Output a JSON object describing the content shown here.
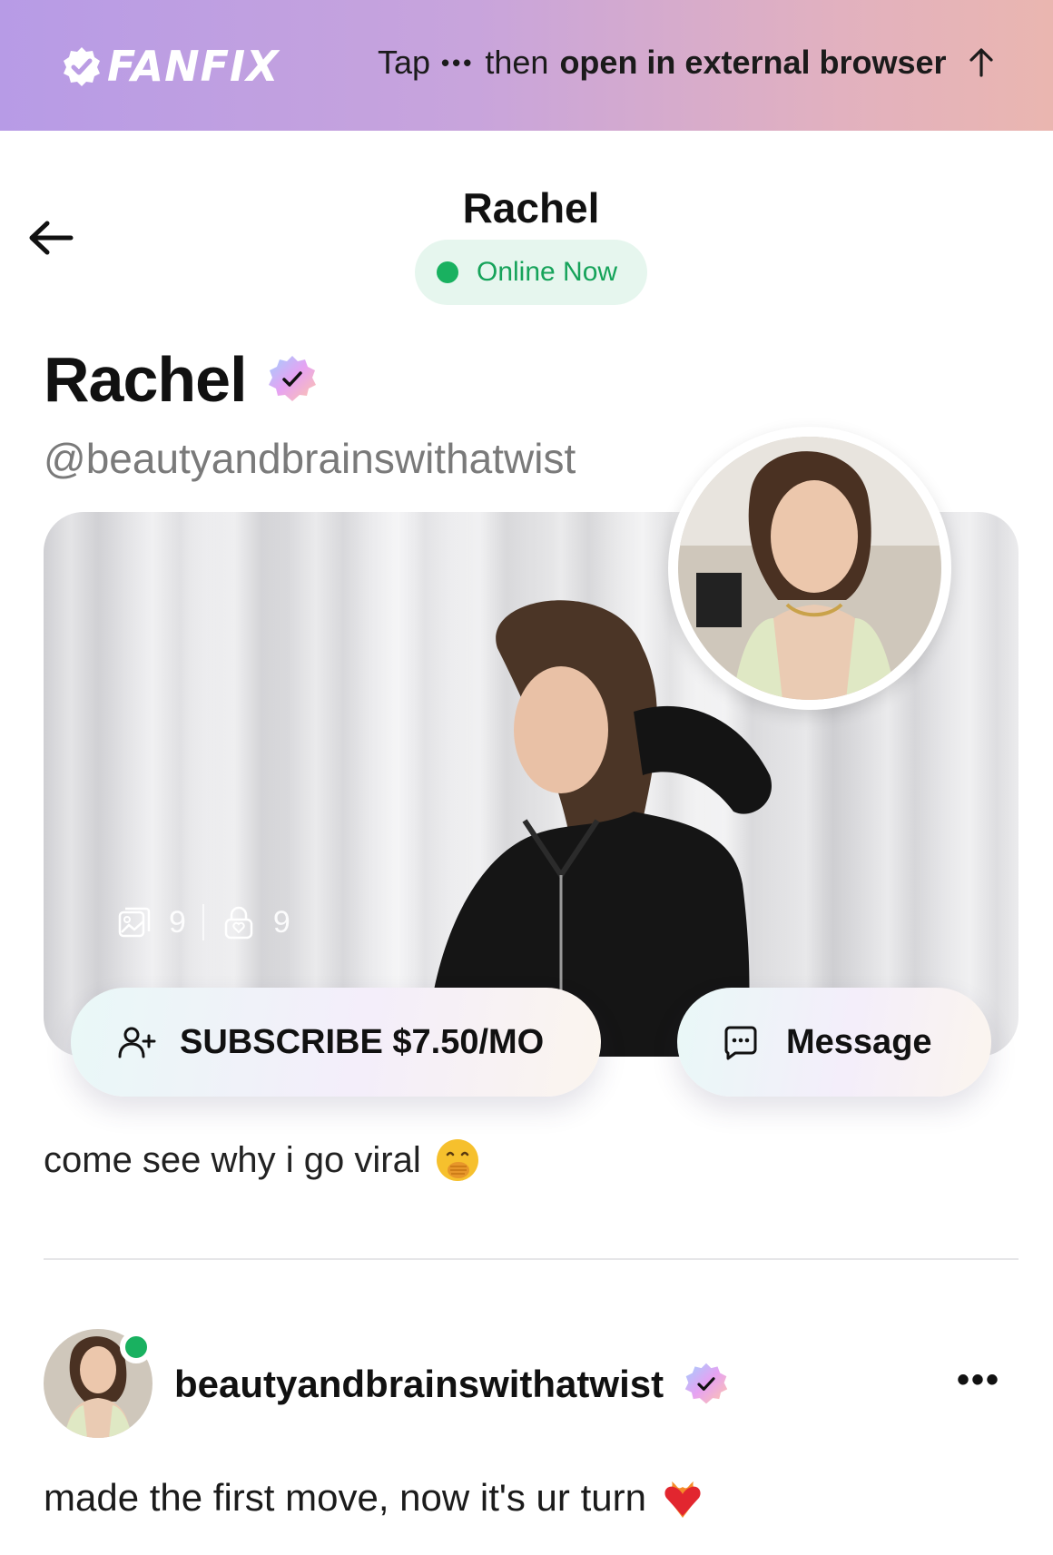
{
  "banner": {
    "logo_text": "FANFIX",
    "tap": "Tap",
    "dots": "•••",
    "then": "then",
    "instruction": "open in external browser"
  },
  "header": {
    "title": "Rachel",
    "status": "Online Now"
  },
  "profile": {
    "name": "Rachel",
    "handle": "@beautyandbrainswithatwist",
    "media_count": "9",
    "locked_count": "9",
    "bio": "come see why i go viral"
  },
  "actions": {
    "subscribe_label": "SUBSCRIBE $7.50/MO",
    "message_label": "Message"
  },
  "post": {
    "username": "beautyandbrainswithatwist",
    "more": "•••",
    "text": "made the first move, now it's ur turn"
  },
  "icons": {
    "back": "arrow-left-icon",
    "up": "arrow-up-icon",
    "verified": "verified-badge-icon",
    "gallery": "gallery-icon",
    "lock": "lock-icon",
    "add_user": "add-user-icon",
    "chat": "chat-bubble-icon",
    "emoji_bio": "hand-over-mouth-emoji",
    "emoji_post": "heart-on-fire-emoji"
  },
  "colors": {
    "online_green": "#19b160",
    "online_bg": "#e6f6ee",
    "banner_start": "#b79be6",
    "banner_end": "#eab6b0"
  }
}
